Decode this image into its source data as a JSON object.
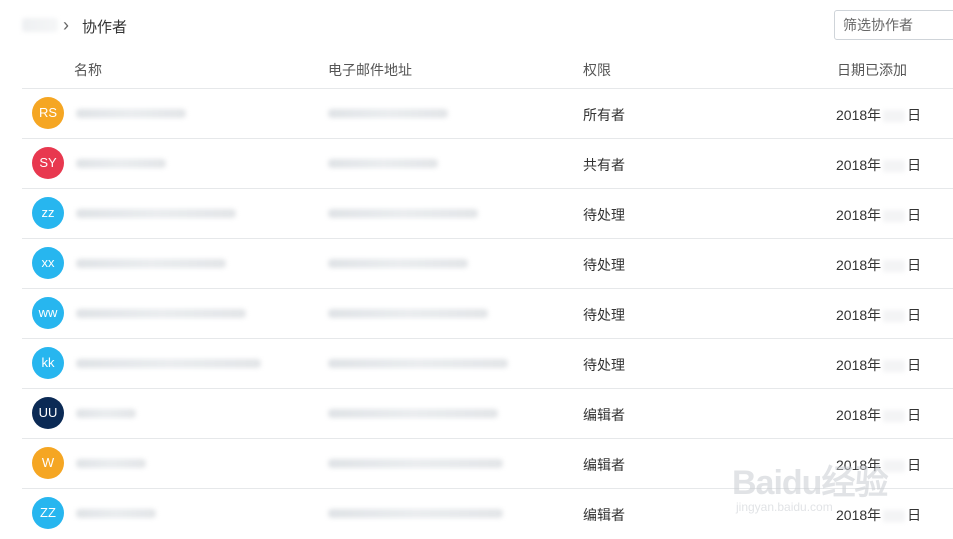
{
  "breadcrumb": {
    "separator": "›",
    "current": "协作者"
  },
  "filter": {
    "placeholder": "筛选协作者"
  },
  "table": {
    "headers": {
      "name": "名称",
      "email": "电子邮件地址",
      "permission": "权限",
      "date_added": "日期已添加"
    },
    "rows": [
      {
        "initials": "RS",
        "color": "#f5a623",
        "permission": "所有者",
        "date_prefix": "2018年",
        "date_suffix": "日"
      },
      {
        "initials": "SY",
        "color": "#e8384f",
        "permission": "共有者",
        "date_prefix": "2018年",
        "date_suffix": "日"
      },
      {
        "initials": "zz",
        "color": "#27b6ef",
        "permission": "待处理",
        "date_prefix": "2018年",
        "date_suffix": "日"
      },
      {
        "initials": "xx",
        "color": "#27b6ef",
        "permission": "待处理",
        "date_prefix": "2018年",
        "date_suffix": "日"
      },
      {
        "initials": "ww",
        "color": "#27b6ef",
        "permission": "待处理",
        "date_prefix": "2018年",
        "date_suffix": "日"
      },
      {
        "initials": "kk",
        "color": "#27b6ef",
        "permission": "待处理",
        "date_prefix": "2018年",
        "date_suffix": "日"
      },
      {
        "initials": "UU",
        "color": "#0b2a55",
        "permission": "编辑者",
        "date_prefix": "2018年",
        "date_suffix": "日"
      },
      {
        "initials": "W",
        "color": "#f5a623",
        "permission": "编辑者",
        "date_prefix": "2018年",
        "date_suffix": "日"
      },
      {
        "initials": "ZZ",
        "color": "#27b6ef",
        "permission": "编辑者",
        "date_prefix": "2018年",
        "date_suffix": "日"
      }
    ]
  },
  "watermark": {
    "logo": "Baidu经验",
    "site": "jingyan.baidu.com"
  }
}
